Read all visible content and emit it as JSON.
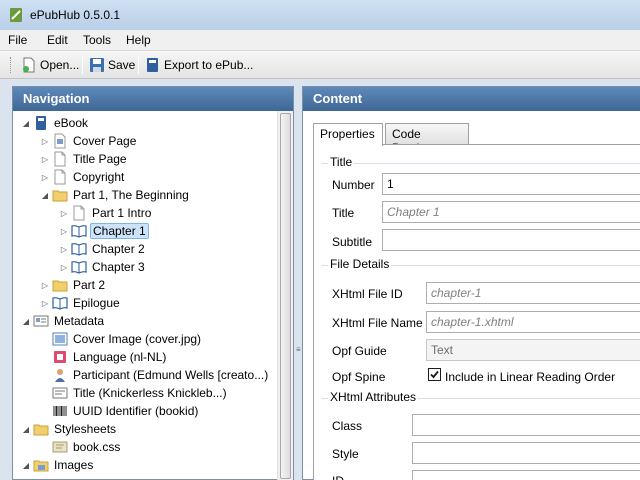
{
  "window": {
    "title": "ePubHub 0.5.0.1"
  },
  "menu": [
    "File",
    "Edit",
    "Tools",
    "Help"
  ],
  "toolbar": {
    "open": "Open...",
    "save": "Save",
    "export": "Export to ePub..."
  },
  "navigation": {
    "header": "Navigation",
    "tree": [
      {
        "label": "eBook",
        "level": 0,
        "expander": "expanded",
        "icon": "book-icon"
      },
      {
        "label": "Cover Page",
        "level": 1,
        "expander": "collapsed",
        "icon": "image-page-icon"
      },
      {
        "label": "Title Page",
        "level": 1,
        "expander": "collapsed",
        "icon": "page-icon"
      },
      {
        "label": "Copyright",
        "level": 1,
        "expander": "collapsed",
        "icon": "page-icon"
      },
      {
        "label": "Part 1, The Beginning",
        "level": 1,
        "expander": "expanded",
        "icon": "folder-icon"
      },
      {
        "label": "Part 1 Intro",
        "level": 2,
        "expander": "collapsed",
        "icon": "page-icon"
      },
      {
        "label": "Chapter 1",
        "level": 2,
        "expander": "collapsed",
        "icon": "open-book-icon",
        "selected": true
      },
      {
        "label": "Chapter 2",
        "level": 2,
        "expander": "collapsed",
        "icon": "open-book-icon"
      },
      {
        "label": "Chapter 3",
        "level": 2,
        "expander": "collapsed",
        "icon": "open-book-icon"
      },
      {
        "label": "Part 2",
        "level": 1,
        "expander": "collapsed",
        "icon": "folder-icon"
      },
      {
        "label": "Epilogue",
        "level": 1,
        "expander": "collapsed",
        "icon": "open-book-icon"
      },
      {
        "label": "Metadata",
        "level": 0,
        "expander": "expanded",
        "icon": "metadata-icon"
      },
      {
        "label": "Cover Image (cover.jpg)",
        "level": 1,
        "expander": "none",
        "icon": "picture-icon"
      },
      {
        "label": "Language (nl-NL)",
        "level": 1,
        "expander": "none",
        "icon": "language-icon"
      },
      {
        "label": "Participant (Edmund Wells [creato...)",
        "level": 1,
        "expander": "none",
        "icon": "person-icon"
      },
      {
        "label": "Title (Knickerless Knickleb...)",
        "level": 1,
        "expander": "none",
        "icon": "title-card-icon"
      },
      {
        "label": "UUID Identifier (bookid)",
        "level": 1,
        "expander": "none",
        "icon": "barcode-icon"
      },
      {
        "label": "Stylesheets",
        "level": 0,
        "expander": "expanded",
        "icon": "folder-icon"
      },
      {
        "label": "book.css",
        "level": 1,
        "expander": "none",
        "icon": "css-icon"
      },
      {
        "label": "Images",
        "level": 0,
        "expander": "expanded",
        "icon": "folder-images-icon"
      }
    ]
  },
  "content": {
    "header": "Content",
    "tabs": [
      "Properties",
      "Code Preview"
    ],
    "active_tab": "Properties",
    "title_group": {
      "label": "Title",
      "number_label": "Number",
      "number_value": "1",
      "title_label": "Title",
      "title_placeholder": "Chapter 1",
      "subtitle_label": "Subtitle",
      "subtitle_value": ""
    },
    "file_group": {
      "label": "File Details",
      "xhtml_id_label": "XHtml File ID",
      "xhtml_id_placeholder": "chapter-1",
      "xhtml_name_label": "XHtml File Name",
      "xhtml_name_placeholder": "chapter-1.xhtml",
      "opf_guide_label": "Opf Guide",
      "opf_guide_value": "Text",
      "opf_spine_label": "Opf Spine",
      "opf_spine_checkbox": "Include in Linear Reading Order",
      "opf_spine_checked": true
    },
    "attr_group": {
      "label": "XHtml Attributes",
      "class_label": "Class",
      "style_label": "Style",
      "id_label": "ID"
    }
  },
  "colors": {
    "header_blue": "#3e6796",
    "selection": "#cde3f8",
    "window_bg": "#dbe4ee"
  }
}
